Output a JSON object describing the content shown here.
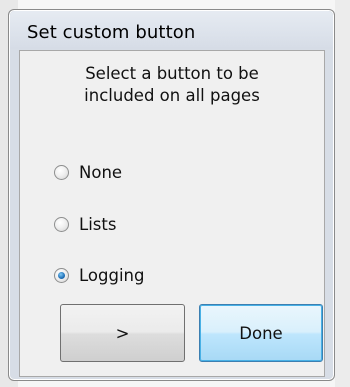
{
  "window": {
    "title": "Set custom button"
  },
  "instruction": {
    "line1": "Select a button to be",
    "line2": "included on all pages"
  },
  "options": [
    {
      "label": "None",
      "checked": false
    },
    {
      "label": "Lists",
      "checked": false
    },
    {
      "label": "Logging",
      "checked": true
    }
  ],
  "buttons": {
    "next_label": ">",
    "done_label": "Done"
  },
  "colors": {
    "title_bar": "#dde3ec",
    "client_bg": "#f0f0f0",
    "radio_selected": "#1f6fb6",
    "default_button_border": "#3c7fb1"
  }
}
